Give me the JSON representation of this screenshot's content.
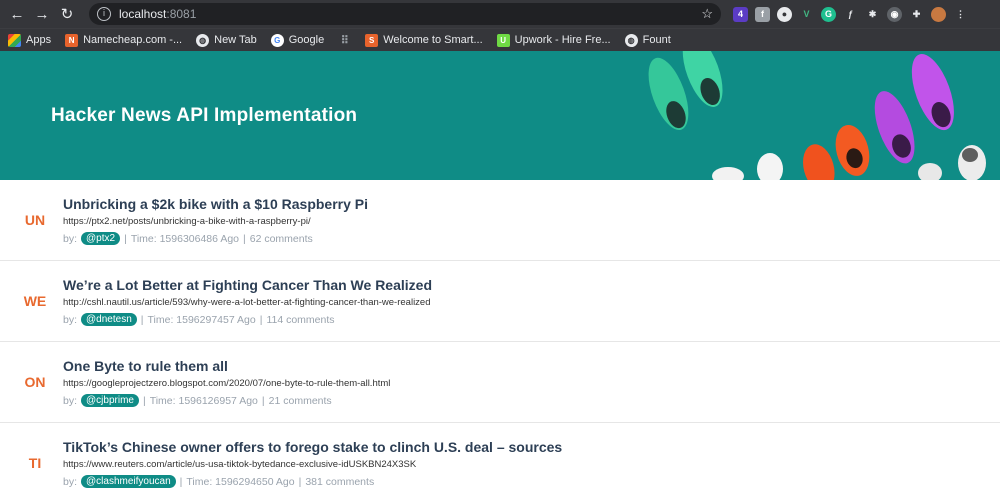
{
  "browser": {
    "url_host": "localhost",
    "url_port": ":8081",
    "bookmarks": [
      {
        "label": "Apps",
        "icon": "apps-grid-icon",
        "color": "#ea4335"
      },
      {
        "label": "Namecheap.com -...",
        "icon": "namecheap-icon",
        "color": "#e8632c"
      },
      {
        "label": "New Tab",
        "icon": "globe-icon",
        "color": "#5f6368"
      },
      {
        "label": "Google",
        "icon": "google-icon",
        "color": "#4285f4"
      },
      {
        "label": "",
        "icon": "grid-icon",
        "color": "#9aa0a6"
      },
      {
        "label": "Welcome to Smart...",
        "icon": "smart-icon",
        "color": "#e8632c"
      },
      {
        "label": "Upwork - Hire Fre...",
        "icon": "upwork-icon",
        "color": "#6fda44"
      },
      {
        "label": "Fount",
        "icon": "globe-icon",
        "color": "#5f6368"
      }
    ]
  },
  "hero": {
    "title": "Hacker News API Implementation",
    "bg_color": "#0f8c86"
  },
  "stories": [
    {
      "initials": "UN",
      "title": "Unbricking a $2k bike with a $10 Raspberry Pi",
      "url": "https://ptx2.net/posts/unbricking-a-bike-with-a-raspberry-pi/",
      "by_label": "by:",
      "author": "@ptx2",
      "time": "Time: 1596306486 Ago",
      "comments": "62 comments"
    },
    {
      "initials": "WE",
      "title": "We’re a Lot Better at Fighting Cancer Than We Realized",
      "url": "http://cshl.nautil.us/article/593/why-were-a-lot-better-at-fighting-cancer-than-we-realized",
      "by_label": "by:",
      "author": "@dnetesn",
      "time": "Time: 1596297457 Ago",
      "comments": "114 comments"
    },
    {
      "initials": "ON",
      "title": "One Byte to rule them all",
      "url": "https://googleprojectzero.blogspot.com/2020/07/one-byte-to-rule-them-all.html",
      "by_label": "by:",
      "author": "@cjbprime",
      "time": "Time: 1596126957 Ago",
      "comments": "21 comments"
    },
    {
      "initials": "TI",
      "title": "TikTok’s Chinese owner offers to forego stake to clinch U.S. deal – sources",
      "url": "https://www.reuters.com/article/us-usa-tiktok-bytedance-exclusive-idUSKBN24X3SK",
      "by_label": "by:",
      "author": "@clashmeifyoucan",
      "time": "Time: 1596294650 Ago",
      "comments": "381 comments"
    }
  ],
  "colors": {
    "accent": "#0f8c86",
    "initials": "#e8692f",
    "title": "#2d3f55"
  }
}
